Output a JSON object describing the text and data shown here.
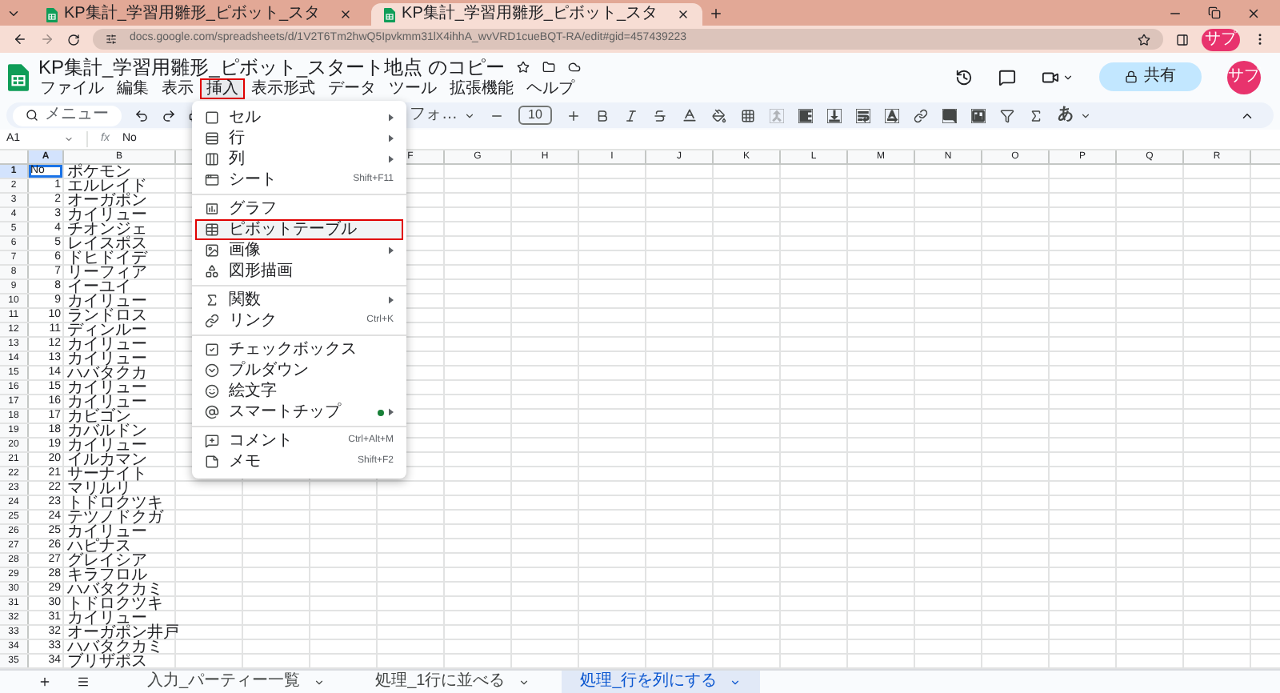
{
  "browser": {
    "tabs": [
      {
        "title": "KP集計_学習用雛形_ピボット_スタ",
        "selected": false
      },
      {
        "title": "KP集計_学習用雛形_ピボット_スタ",
        "selected": true
      }
    ],
    "url": "docs.google.com/spreadsheets/d/1V2T6Tm2hwQ5Ipvkmm31lX4ihhA_wvVRD1cueBQT-RA/edit#gid=457439223",
    "profile": "サプ"
  },
  "doc": {
    "title": "KP集計_学習用雛形_ピボット_スタート地点 のコピー",
    "share": "共有",
    "avatar": "サプ"
  },
  "menubar": [
    {
      "label": "ファイル",
      "marked": false
    },
    {
      "label": "編集",
      "marked": false
    },
    {
      "label": "表示",
      "marked": false
    },
    {
      "label": "挿入",
      "marked": true
    },
    {
      "label": "表示形式",
      "marked": false
    },
    {
      "label": "データ",
      "marked": false
    },
    {
      "label": "ツール",
      "marked": false
    },
    {
      "label": "拡張機能",
      "marked": false
    },
    {
      "label": "ヘルプ",
      "marked": false
    }
  ],
  "toolbar": {
    "search": "メニュー",
    "font": "フォ…",
    "font_size": "10",
    "input_mode": "あ"
  },
  "formula_bar": {
    "cell": "A1",
    "fx": "fx",
    "value": "No"
  },
  "columns": [
    {
      "label": "A",
      "selected": true
    },
    {
      "label": "B",
      "selected": false
    },
    {
      "label": "F",
      "selected": false
    },
    {
      "label": "G",
      "selected": false
    },
    {
      "label": "H",
      "selected": false
    },
    {
      "label": "I",
      "selected": false
    },
    {
      "label": "J",
      "selected": false
    },
    {
      "label": "K",
      "selected": false
    },
    {
      "label": "L",
      "selected": false
    },
    {
      "label": "M",
      "selected": false
    },
    {
      "label": "N",
      "selected": false
    },
    {
      "label": "O",
      "selected": false
    },
    {
      "label": "P",
      "selected": false
    },
    {
      "label": "Q",
      "selected": false
    },
    {
      "label": "R",
      "selected": false
    }
  ],
  "rows": [
    {
      "number": "1",
      "a": "No",
      "b": "ポケモン",
      "selected": true
    },
    {
      "number": "2",
      "a": "1",
      "b": "エルレイド",
      "selected": false
    },
    {
      "number": "3",
      "a": "2",
      "b": "オーガポン",
      "selected": false
    },
    {
      "number": "4",
      "a": "3",
      "b": "カイリュー",
      "selected": false
    },
    {
      "number": "5",
      "a": "4",
      "b": "チオンジェ",
      "selected": false
    },
    {
      "number": "6",
      "a": "5",
      "b": "レイスポス",
      "selected": false
    },
    {
      "number": "7",
      "a": "6",
      "b": "ドヒドイデ",
      "selected": false
    },
    {
      "number": "8",
      "a": "7",
      "b": "リーフィア",
      "selected": false
    },
    {
      "number": "9",
      "a": "8",
      "b": "イーユイ",
      "selected": false
    },
    {
      "number": "10",
      "a": "9",
      "b": "カイリュー",
      "selected": false
    },
    {
      "number": "11",
      "a": "10",
      "b": "ランドロス",
      "selected": false
    },
    {
      "number": "12",
      "a": "11",
      "b": "ディンルー",
      "selected": false
    },
    {
      "number": "13",
      "a": "12",
      "b": "カイリュー",
      "selected": false
    },
    {
      "number": "14",
      "a": "13",
      "b": "カイリュー",
      "selected": false
    },
    {
      "number": "15",
      "a": "14",
      "b": "ハバタクカ",
      "selected": false
    },
    {
      "number": "16",
      "a": "15",
      "b": "カイリュー",
      "selected": false
    },
    {
      "number": "17",
      "a": "16",
      "b": "カイリュー",
      "selected": false
    },
    {
      "number": "18",
      "a": "17",
      "b": "カビゴン",
      "selected": false
    },
    {
      "number": "19",
      "a": "18",
      "b": "カバルドン",
      "selected": false
    },
    {
      "number": "20",
      "a": "19",
      "b": "カイリュー",
      "selected": false
    },
    {
      "number": "21",
      "a": "20",
      "b": "イルカマン",
      "selected": false
    },
    {
      "number": "22",
      "a": "21",
      "b": "サーナイト",
      "selected": false
    },
    {
      "number": "23",
      "a": "22",
      "b": "マリルリ",
      "selected": false
    },
    {
      "number": "24",
      "a": "23",
      "b": "トドロクツキ",
      "selected": false
    },
    {
      "number": "25",
      "a": "24",
      "b": "テツノドクガ",
      "selected": false
    },
    {
      "number": "26",
      "a": "25",
      "b": "カイリュー",
      "selected": false
    },
    {
      "number": "27",
      "a": "26",
      "b": "ハピナス",
      "selected": false
    },
    {
      "number": "28",
      "a": "27",
      "b": "グレイシア",
      "selected": false
    },
    {
      "number": "29",
      "a": "28",
      "b": "キラフロル",
      "selected": false
    },
    {
      "number": "30",
      "a": "29",
      "b": "ハバタクカミ",
      "selected": false
    },
    {
      "number": "31",
      "a": "30",
      "b": "トドロクツキ",
      "selected": false
    },
    {
      "number": "32",
      "a": "31",
      "b": "カイリュー",
      "selected": false
    },
    {
      "number": "33",
      "a": "32",
      "b": "オーガポン井戸",
      "selected": false
    },
    {
      "number": "34",
      "a": "33",
      "b": "ハバタクカミ",
      "selected": false
    },
    {
      "number": "35",
      "a": "34",
      "b": "ブリザポス",
      "selected": false
    }
  ],
  "insert_menu": {
    "sections": [
      [
        {
          "label": "セル",
          "submenu": true,
          "marked": false
        },
        {
          "label": "行",
          "submenu": true,
          "marked": false
        },
        {
          "label": "列",
          "submenu": true,
          "marked": false
        },
        {
          "label": "シート",
          "shortcut": "Shift+F11",
          "submenu": false,
          "marked": false
        }
      ],
      [
        {
          "label": "グラフ",
          "submenu": false,
          "marked": false
        },
        {
          "label": "ピボットテーブル",
          "submenu": false,
          "marked": true
        },
        {
          "label": "画像",
          "submenu": true,
          "marked": false
        },
        {
          "label": "図形描画",
          "submenu": false,
          "marked": false
        }
      ],
      [
        {
          "label": "関数",
          "submenu": true,
          "marked": false
        },
        {
          "label": "リンク",
          "shortcut": "Ctrl+K",
          "submenu": false,
          "marked": false
        }
      ],
      [
        {
          "label": "チェックボックス",
          "submenu": false,
          "marked": false
        },
        {
          "label": "プルダウン",
          "submenu": false,
          "marked": false
        },
        {
          "label": "絵文字",
          "submenu": false,
          "marked": false
        },
        {
          "label": "スマートチップ",
          "submenu": true,
          "marked": false,
          "new_dot": true
        }
      ],
      [
        {
          "label": "コメント",
          "shortcut": "Ctrl+Alt+M",
          "submenu": false,
          "marked": false
        },
        {
          "label": "メモ",
          "shortcut": "Shift+F2",
          "submenu": false,
          "marked": false
        }
      ]
    ]
  },
  "sheet_tabs": [
    {
      "label": "入力_パーティー一覧",
      "selected": false
    },
    {
      "label": "処理_1行に並べる",
      "selected": false
    },
    {
      "label": "処理_行を列にする",
      "selected": true
    }
  ]
}
